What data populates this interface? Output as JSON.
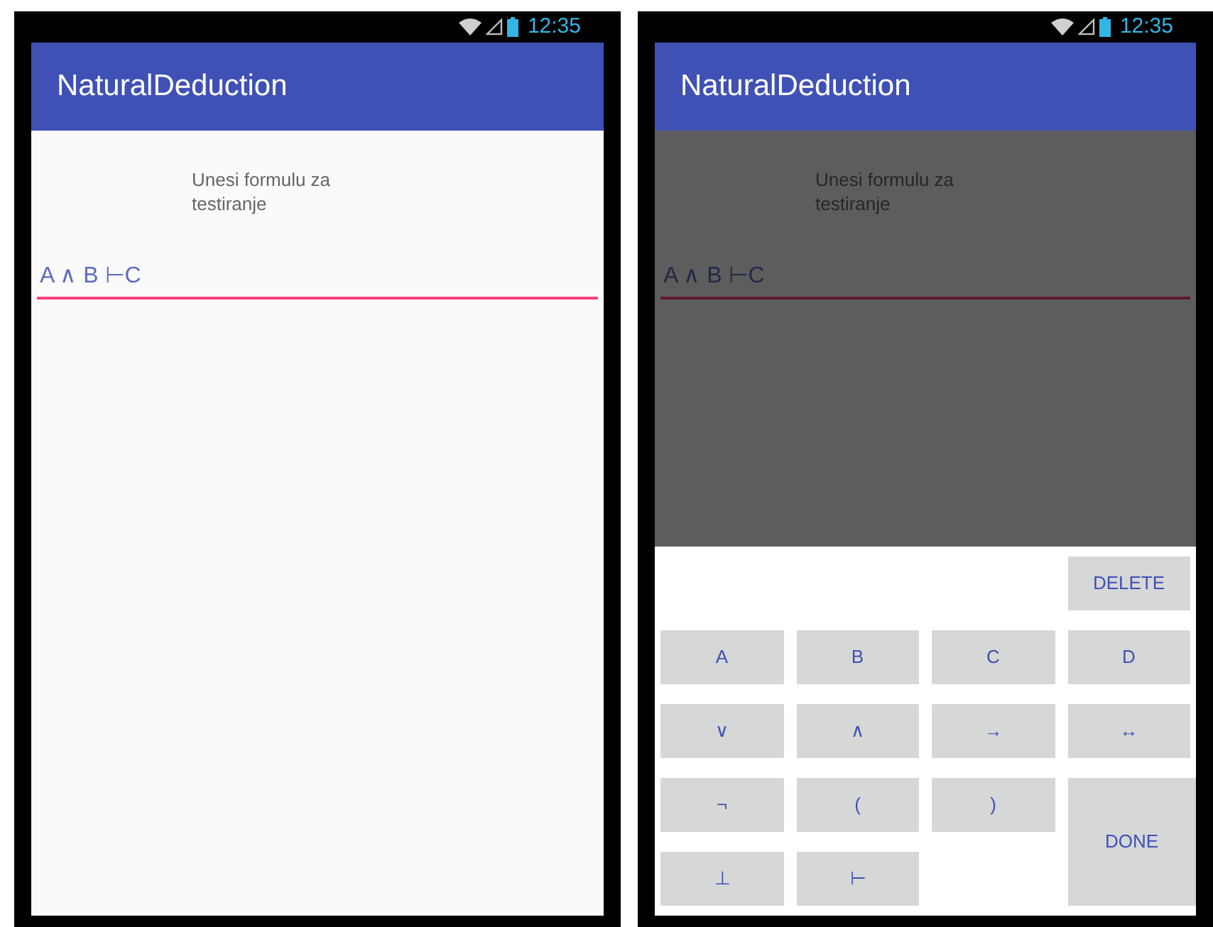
{
  "screens": [
    {
      "status_time": "12:35",
      "title": "NaturalDeduction",
      "prompt": "Unesi formulu za testiranje",
      "formula": "A ∧ B ⊢C",
      "dimmed": false
    },
    {
      "status_time": "12:35",
      "title": "NaturalDeduction",
      "prompt": "Unesi formulu za testiranje",
      "formula": "A ∧ B ⊢C",
      "dimmed": true,
      "keyboard": {
        "keys": [
          {
            "label": "DELETE",
            "kind": "wide"
          },
          {
            "label": "A",
            "kind": "key"
          },
          {
            "label": "B",
            "kind": "key"
          },
          {
            "label": "C",
            "kind": "key"
          },
          {
            "label": "D",
            "kind": "key"
          },
          {
            "label": "∨",
            "kind": "key"
          },
          {
            "label": "∧",
            "kind": "key"
          },
          {
            "label": "→",
            "kind": "key"
          },
          {
            "label": "↔",
            "kind": "key"
          },
          {
            "label": "¬",
            "kind": "key"
          },
          {
            "label": "(",
            "kind": "key"
          },
          {
            "label": ")",
            "kind": "key"
          },
          {
            "label": "DONE",
            "kind": "tall"
          },
          {
            "label": "⊥",
            "kind": "key"
          },
          {
            "label": "⊢",
            "kind": "key"
          }
        ]
      }
    }
  ]
}
